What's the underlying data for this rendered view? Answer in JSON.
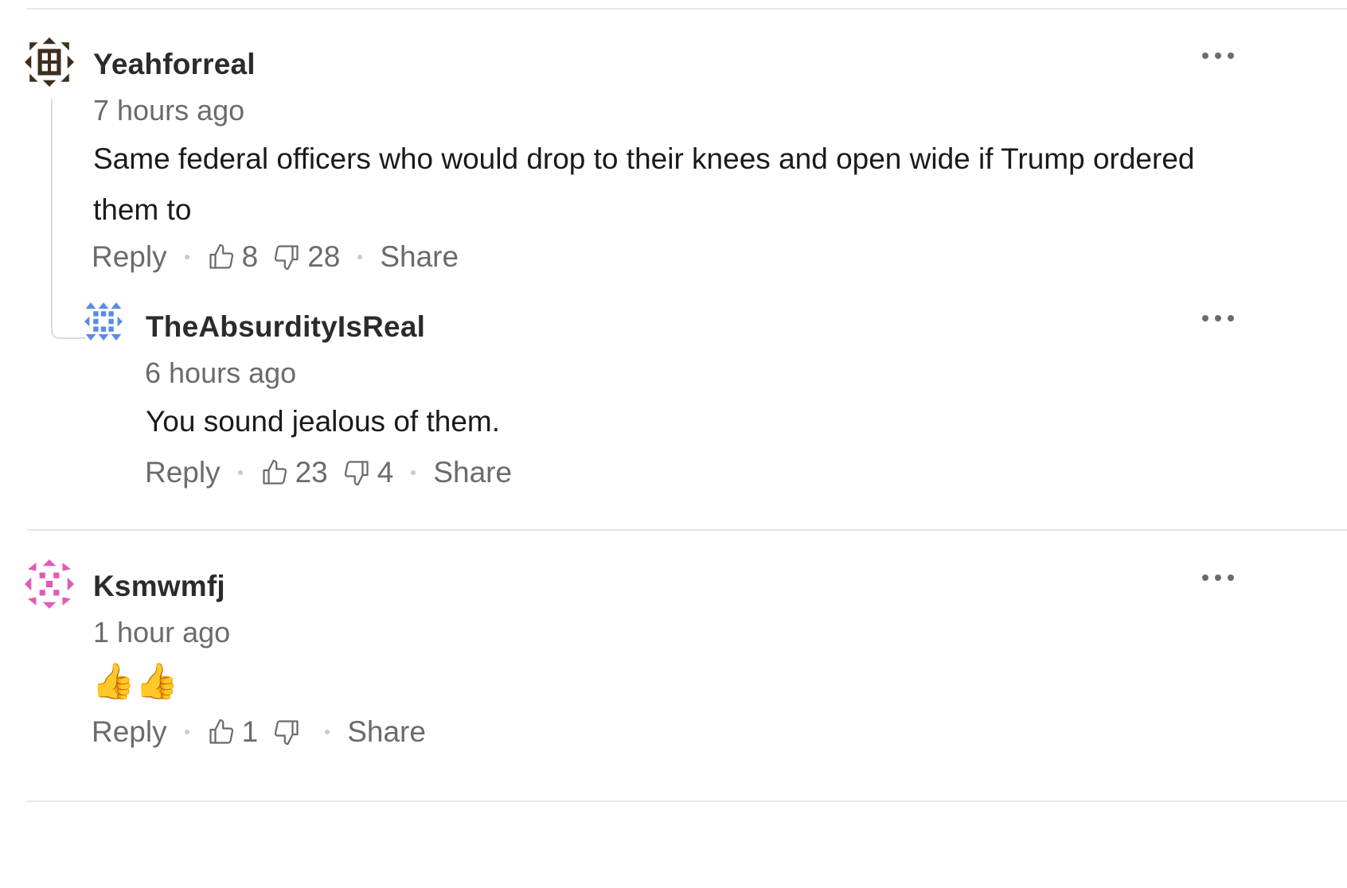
{
  "comments": [
    {
      "username": "Yeahforreal",
      "time": "7 hours ago",
      "text": "Same federal officers who would drop to their knees and open wide if Trump ordered them to",
      "reply_label": "Reply",
      "likes": "8",
      "dislikes": "28",
      "share_label": "Share",
      "avatar_color": "#3d2e1f",
      "more_icon": "more-dots-icon"
    },
    {
      "username": "TheAbsurdityIsReal",
      "time": "6 hours ago",
      "text": "You sound jealous of them.",
      "reply_label": "Reply",
      "likes": "23",
      "dislikes": "4",
      "share_label": "Share",
      "avatar_color": "#5b8be8",
      "more_icon": "more-dots-icon"
    },
    {
      "username": "Ksmwmfj",
      "time": "1 hour ago",
      "text": "👍👍",
      "reply_label": "Reply",
      "likes": "1",
      "dislikes": "",
      "share_label": "Share",
      "avatar_color": "#e25ab7",
      "more_icon": "more-dots-icon"
    }
  ],
  "colors": {
    "muted_text": "#6b6b6b",
    "divider": "#e6e6e6",
    "username": "#2b2b2b"
  }
}
